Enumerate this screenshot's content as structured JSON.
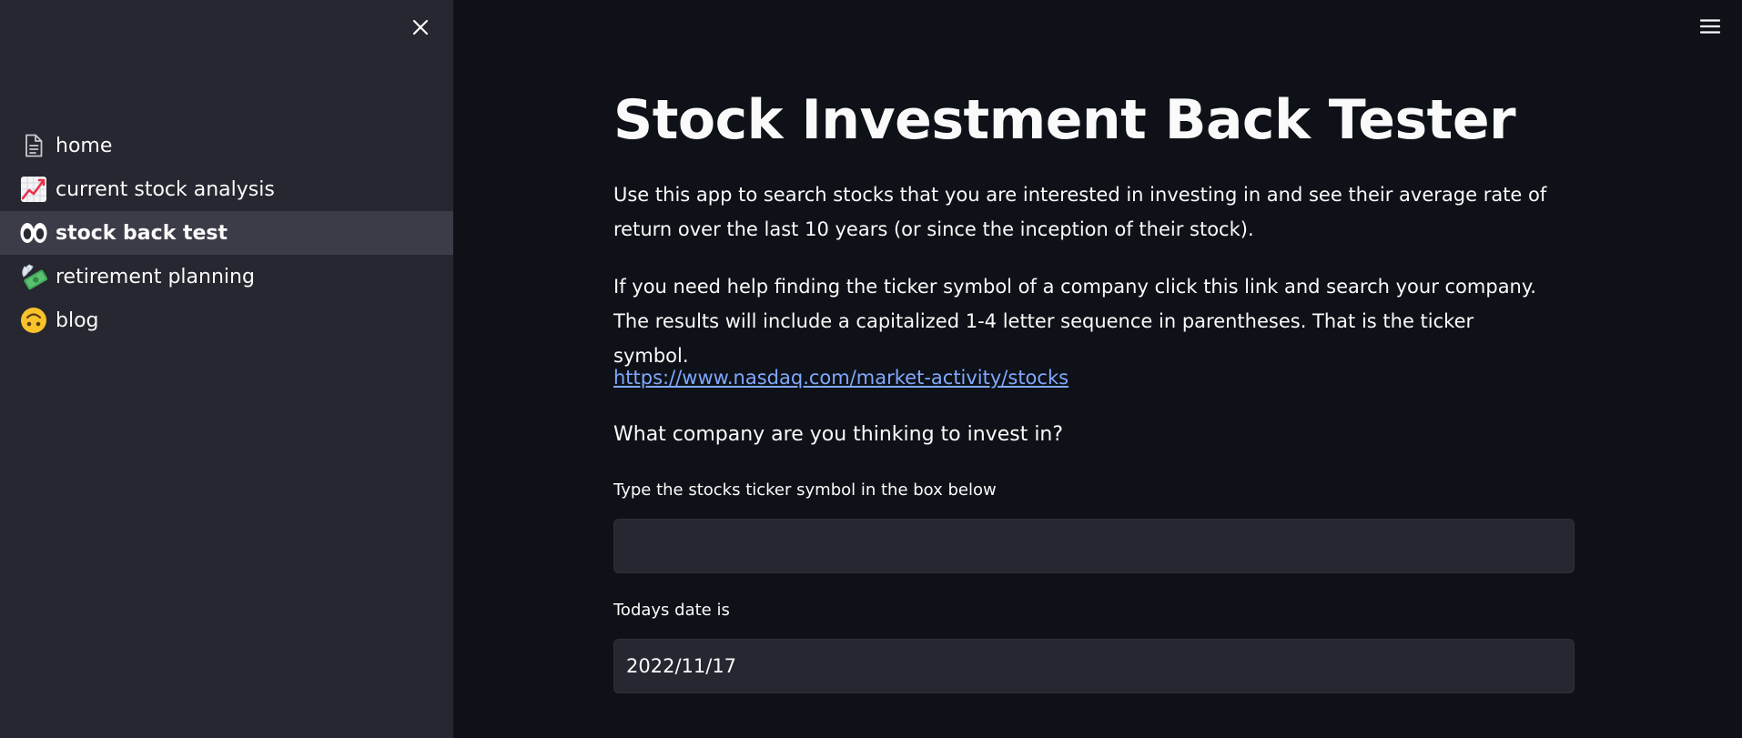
{
  "sidebar": {
    "items": [
      {
        "label": "home",
        "icon": "document-icon"
      },
      {
        "label": "current stock analysis",
        "icon": "chart-increasing-icon"
      },
      {
        "label": "stock back test",
        "icon": "eyes-icon",
        "active": true
      },
      {
        "label": "retirement planning",
        "icon": "money-with-wings-icon"
      },
      {
        "label": "blog",
        "icon": "upside-down-face-icon"
      }
    ]
  },
  "main": {
    "title": "Stock Investment Back Tester",
    "intro": "Use this app to search stocks that you are interested in investing in and see their average rate of return over the last 10 years (or since the inception of their stock).",
    "help": "If you need help finding the ticker symbol of a company click this link and search your company. The results will include a capitalized 1-4 letter sequence in parentheses. That is the ticker symbol.",
    "link": "https://www.nasdaq.com/market-activity/stocks",
    "question": "What company are you thinking to invest in?",
    "ticker_label": "Type the stocks ticker symbol in the box below",
    "ticker_value": "",
    "date_label": "Todays date is",
    "date_value": "2022/11/17"
  },
  "colors": {
    "background": "#0e1117",
    "sidebar": "#262730",
    "active_item": "#3b3c47",
    "link": "#80a8ff",
    "text": "#fafafa"
  }
}
